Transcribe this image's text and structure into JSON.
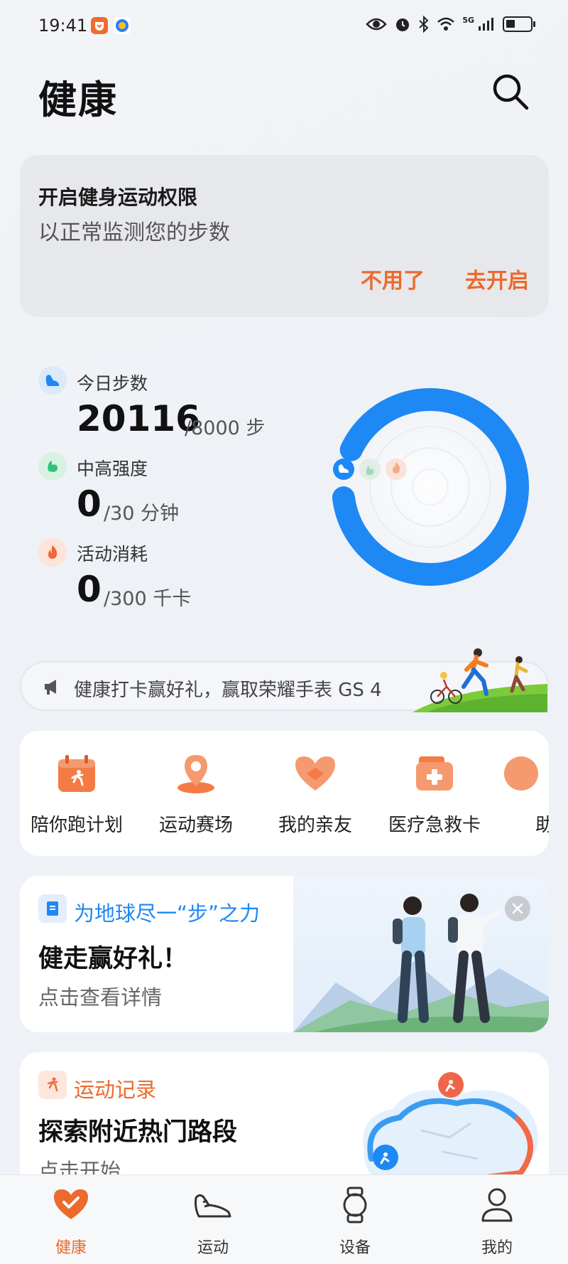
{
  "status": {
    "time": "19:41",
    "network": "5G"
  },
  "header": {
    "title": "健康"
  },
  "permission_card": {
    "title": "开启健身运动权限",
    "subtitle": "以正常监测您的步数",
    "dismiss_label": "不用了",
    "enable_label": "去开启"
  },
  "stats": {
    "steps": {
      "label": "今日步数",
      "value": "20116",
      "goal": "/8000 步",
      "progress": 1.0,
      "color": "#1e88f5"
    },
    "intensity": {
      "label": "中高强度",
      "value": "0",
      "goal": "/30 分钟",
      "progress": 0,
      "color": "#33c27a"
    },
    "calories": {
      "label": "活动消耗",
      "value": "0",
      "goal": "/300 千卡",
      "progress": 0,
      "color": "#f0653a"
    }
  },
  "banner": {
    "text": "健康打卡赢好礼，赢取荣耀手表 GS 4"
  },
  "shortcuts": [
    {
      "label": "陪你跑计划"
    },
    {
      "label": "运动赛场"
    },
    {
      "label": "我的亲友"
    },
    {
      "label": "医疗急救卡"
    },
    {
      "label": "助眠"
    }
  ],
  "earth_card": {
    "tag": "为地球尽一“步”之力",
    "title": "健走赢好礼！",
    "subtitle": "点击查看详情"
  },
  "record_card": {
    "tag": "运动记录",
    "title": "探索附近热门路段",
    "subtitle": "点击开始"
  },
  "bottom_nav": [
    {
      "label": "健康",
      "active": true
    },
    {
      "label": "运动",
      "active": false
    },
    {
      "label": "设备",
      "active": false
    },
    {
      "label": "我的",
      "active": false
    }
  ],
  "colors": {
    "accent": "#ec6a2c",
    "steps_ring": "#1e88f5"
  }
}
